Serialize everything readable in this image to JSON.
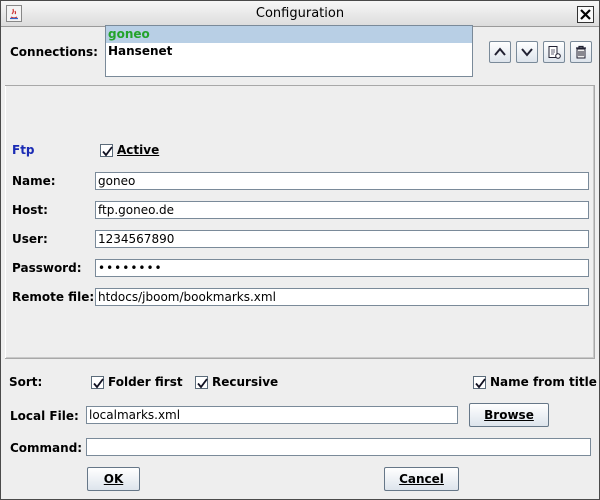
{
  "window": {
    "title": "Configuration"
  },
  "connections": {
    "label": "Connections:",
    "items": [
      {
        "name": "goneo",
        "selected": true
      },
      {
        "name": "Hansenet",
        "selected": false
      }
    ],
    "side_buttons": [
      "move-up-icon",
      "move-down-icon",
      "copy-icon",
      "delete-icon"
    ]
  },
  "ftp": {
    "label": "Ftp",
    "active_label": "Active",
    "active_checked": true,
    "fields": {
      "name": {
        "label": "Name:",
        "value": "goneo"
      },
      "host": {
        "label": "Host:",
        "value": "ftp.goneo.de"
      },
      "user": {
        "label": "User:",
        "value": "1234567890"
      },
      "password": {
        "label": "Password:",
        "value": "••••••••"
      },
      "remote_file": {
        "label": "Remote file:",
        "value": "htdocs/jboom/bookmarks.xml"
      }
    }
  },
  "sort": {
    "label": "Sort:",
    "folder_first": {
      "label": "Folder first",
      "checked": true
    },
    "recursive": {
      "label": "Recursive",
      "checked": true
    },
    "name_from_title": {
      "label": "Name from title",
      "checked": true
    }
  },
  "local_file": {
    "label": "Local File:",
    "value": "localmarks.xml",
    "browse_label": "Browse"
  },
  "command": {
    "label": "Command:",
    "value": ""
  },
  "buttons": {
    "ok": "OK",
    "cancel": "Cancel"
  },
  "colors": {
    "selected_item_text": "#23a32b",
    "selected_item_bg": "#b8cfe5",
    "ftp_label": "#1a2bb4"
  }
}
